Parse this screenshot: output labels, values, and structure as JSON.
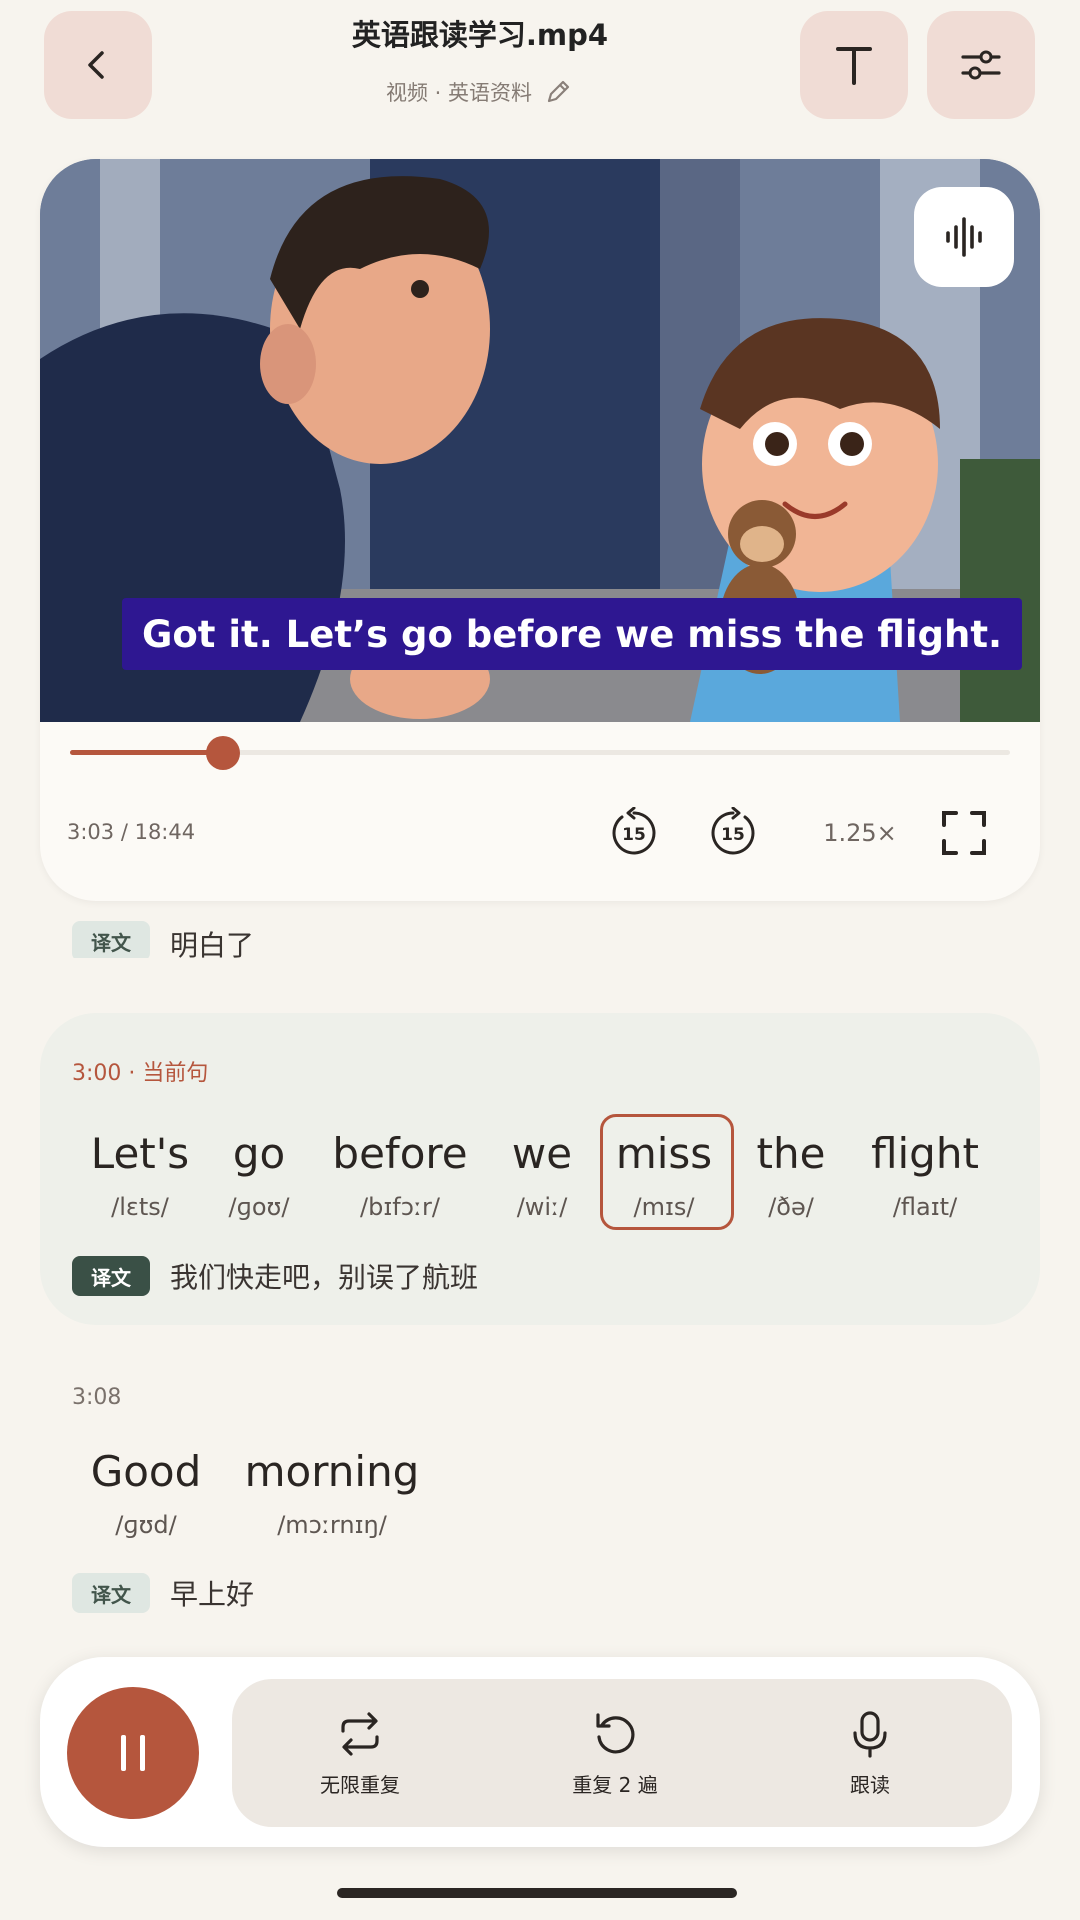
{
  "header": {
    "title": "英语跟读学习.mp4",
    "subtitle": "视频 · 英语资料",
    "back_icon": "chevron-left-icon",
    "text_icon": "text-format-icon",
    "settings_icon": "sliders-icon"
  },
  "player": {
    "subtitle_text": "Got it. Let’s go before we miss the flight.",
    "time": "3:03 / 18:44",
    "progress": 0.1627,
    "rewind_label": "15",
    "forward_label": "15",
    "speed": "1.25×"
  },
  "transcript": {
    "prev_tag": "译文",
    "prev_translation": "明白了",
    "current": {
      "time": "3:00",
      "marker": "· 当前句",
      "words": [
        {
          "w": "Let's",
          "p": "/lɛts/"
        },
        {
          "w": "go",
          "p": "/ɡoʊ/"
        },
        {
          "w": "before",
          "p": "/bɪfɔːr/"
        },
        {
          "w": "we",
          "p": "/wiː/"
        },
        {
          "w": "miss",
          "p": "/mɪs/"
        },
        {
          "w": "the",
          "p": "/ðə/"
        },
        {
          "w": "flight",
          "p": "/flaɪt/"
        }
      ],
      "highlighted": "miss",
      "tag": "译文",
      "translation": "我们快走吧，别误了航班"
    },
    "next": {
      "time": "3:08",
      "words": [
        {
          "w": "Good",
          "p": "/ɡʊd/"
        },
        {
          "w": "morning",
          "p": "/mɔːrnɪŋ/"
        }
      ],
      "tag": "译文",
      "translation": "早上好"
    }
  },
  "bottom_bar": {
    "loop_label": "无限重复",
    "repeat_label": "重复 2 遍",
    "shadow_label": "跟读"
  },
  "colors": {
    "accent": "#b5563d",
    "background": "#f7f4ee",
    "caption_bg": "#2e1791"
  }
}
